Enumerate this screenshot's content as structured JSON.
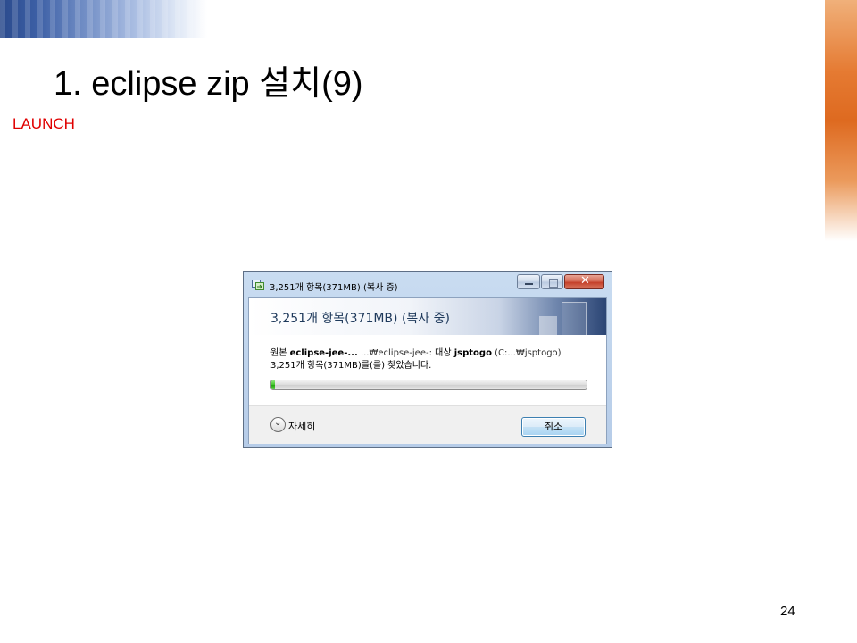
{
  "slide": {
    "title": "1. eclipse zip 설치(9)",
    "subtitle": "LAUNCH",
    "page_number": "24"
  },
  "dialog": {
    "window_title": "3,251개 항목(371MB) (복사 중)",
    "banner_title": "3,251개 항목(371MB) (복사 중)",
    "source_label": "원본",
    "source_name": "eclipse-jee-...",
    "source_path": "...₩eclipse-jee-:",
    "dest_label": "대상",
    "dest_name": "jsptogo",
    "dest_path": "(C:...₩jsptogo)",
    "status_text": "3,251개 항목(371MB)를(를) 찾았습니다.",
    "progress_percent": 1,
    "details_label": "자세히",
    "cancel_label": "취소",
    "icons": [
      "copy-window-icon",
      "minimize-icon",
      "maximize-icon",
      "close-icon",
      "chevron-down-icon"
    ],
    "colors": {
      "progress_green": "#3fc32a",
      "banner_title": "#1e395b",
      "close_red": "#c4402a"
    }
  }
}
